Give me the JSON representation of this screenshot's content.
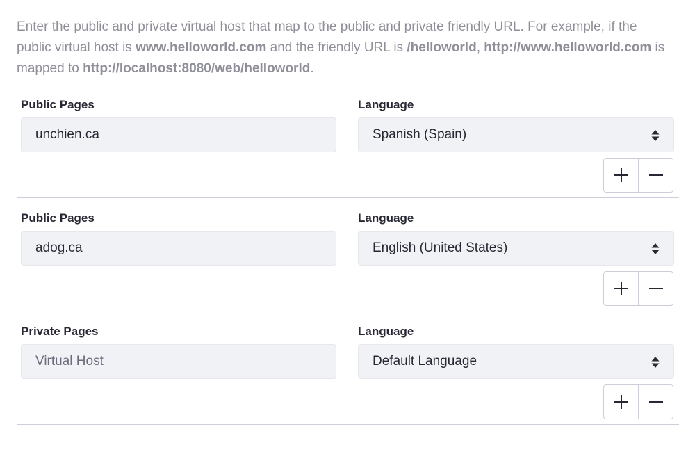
{
  "help": {
    "part1": "Enter the public and private virtual host that map to the public and private friendly URL. For example, if the public virtual host is ",
    "example_host": "www.helloworld.com",
    "part2": " and the friendly URL is ",
    "example_friendly_url": "/helloworld",
    "part3": ", ",
    "example_full_url": "http://www.helloworld.com",
    "part4": " is mapped to ",
    "example_mapped_url": "http://localhost:8080/web/helloworld",
    "part5": "."
  },
  "rows": [
    {
      "host_label": "Public Pages",
      "host_value": "unchien.ca",
      "host_placeholder": "",
      "language_label": "Language",
      "language_value": "Spanish (Spain)"
    },
    {
      "host_label": "Public Pages",
      "host_value": "adog.ca",
      "host_placeholder": "",
      "language_label": "Language",
      "language_value": "English (United States)"
    },
    {
      "host_label": "Private Pages",
      "host_value": "",
      "host_placeholder": "Virtual Host",
      "language_label": "Language",
      "language_value": "Default Language"
    }
  ],
  "icons": {
    "add": "plus-icon",
    "remove": "minus-icon",
    "select": "caret-double-icon"
  },
  "colors": {
    "help_text": "#8f8f99",
    "input_bg": "#f1f2f5",
    "border": "#cdced9",
    "text": "#272833"
  }
}
